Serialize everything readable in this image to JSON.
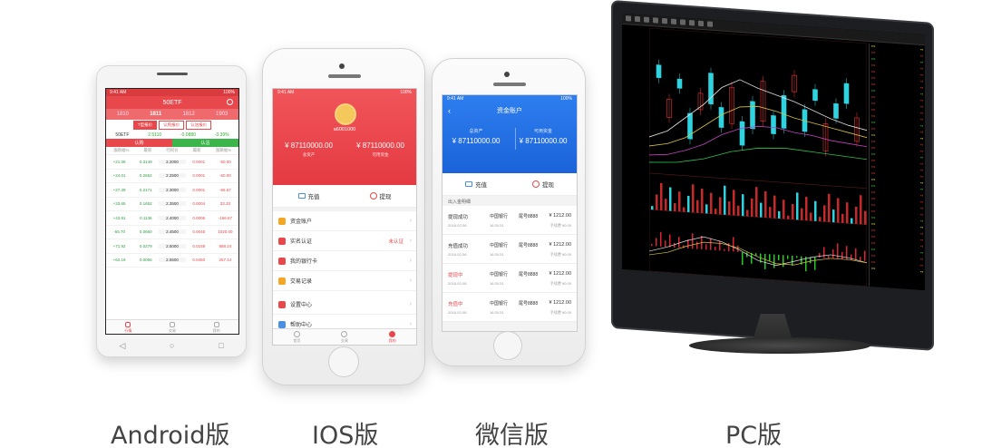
{
  "labels": {
    "android": "Android版",
    "ios": "IOS版",
    "wechat": "微信版",
    "pc": "PC版"
  },
  "android": {
    "status_time": "9:41 AM",
    "status_battery": "100%",
    "title": "50ETF",
    "months": [
      "1810",
      "1811",
      "1812",
      "1903"
    ],
    "active_month_index": 1,
    "subtabs": [
      "T型报价",
      "认购报价",
      "认沽报价"
    ],
    "quote": {
      "code": "50ETF",
      "price": "2.5110",
      "change": "-0.0880",
      "pct": "-3.39%"
    },
    "call_label": "认购",
    "put_label": "认沽",
    "columns": [
      "涨跌幅%",
      "最新",
      "行权价",
      "最新",
      "涨跌幅%"
    ],
    "rows": [
      [
        "+21.08",
        "0.3149",
        "2.2000",
        "0.0001",
        "-50.00"
      ],
      [
        "+24.01",
        "0.2652",
        "2.2500",
        "0.0001",
        "-50.00"
      ],
      [
        "+27.39",
        "0.2171",
        "2.3000",
        "0.0001",
        "-66.67"
      ],
      [
        "+33.65",
        "0.1652",
        "2.3500",
        "0.0004",
        "33.33"
      ],
      [
        "+43.81",
        "0.1136",
        "2.4000",
        "0.0006",
        "-166.67"
      ],
      [
        "-55.70",
        "0.0660",
        "2.4500",
        "0.0045",
        "1020.00"
      ],
      [
        "+71.92",
        "0.0279",
        "2.5000",
        "0.0159",
        "888.24"
      ],
      [
        "+62.19",
        "0.0056",
        "2.5500",
        "0.0450",
        "257.14"
      ]
    ],
    "tabbar": [
      "行情",
      "交易",
      "我的"
    ]
  },
  "ios": {
    "status_time": "9:41 AM",
    "status_battery": "100%",
    "uid": "a6001000",
    "balance_total": "¥ 87110000.00",
    "balance_total_label": "总资产",
    "balance_available": "¥ 87110000.00",
    "balance_available_label": "可用资金",
    "action_recharge": "充值",
    "action_withdraw": "提现",
    "menu": [
      {
        "label": "资金账户",
        "tag": "",
        "color": "#f5a623"
      },
      {
        "label": "实名认证",
        "tag": "未认证",
        "color": "#e8474b"
      },
      {
        "label": "我的银行卡",
        "tag": "",
        "color": "#e8474b"
      },
      {
        "label": "交易记录",
        "tag": "",
        "color": "#f5a623"
      },
      {
        "label": "设置中心",
        "tag": "",
        "color": "#e8474b"
      },
      {
        "label": "帮助中心",
        "tag": "",
        "color": "#4a90e2"
      }
    ],
    "tabbar": [
      "首页",
      "交易",
      "我的"
    ]
  },
  "wechat": {
    "status_time": "9:41 AM",
    "status_battery": "100%",
    "title": "资金账户",
    "total_label": "总资产",
    "total_value": "¥ 87110000.00",
    "avail_label": "可用资金",
    "avail_value": "¥ 87110000.00",
    "action_recharge": "充值",
    "action_withdraw": "提现",
    "section": "出入金明细",
    "records": [
      {
        "status": "提现成功",
        "status_color": "#333",
        "date": "2018-02-08",
        "time": "16:30:31",
        "bank": "中国银行",
        "card": "尾号8888",
        "amount": "¥ 1212.00",
        "fee": "手续费 ¥0.00"
      },
      {
        "status": "充值成功",
        "status_color": "#333",
        "date": "2018-02-08",
        "time": "16:30:31",
        "bank": "中国银行",
        "card": "尾号8888",
        "amount": "¥ 1212.00",
        "fee": "手续费 ¥0.00"
      },
      {
        "status": "提现中",
        "status_color": "#e8474b",
        "date": "2018-02-08",
        "time": "16:30:31",
        "bank": "中国银行",
        "card": "尾号8888",
        "amount": "¥ 1212.00",
        "fee": "手续费 ¥0.00"
      },
      {
        "status": "充值中",
        "status_color": "#e8474b",
        "date": "2018-02-08",
        "time": "16:30:31",
        "bank": "中国银行",
        "card": "尾号8888",
        "amount": "¥ 1212.00",
        "fee": "手续费 ¥0.00"
      }
    ]
  },
  "colors": {
    "brand_red": "#e8474b",
    "wechat_blue": "#1a63d8",
    "up": "#e33333",
    "down": "#33cc33"
  }
}
